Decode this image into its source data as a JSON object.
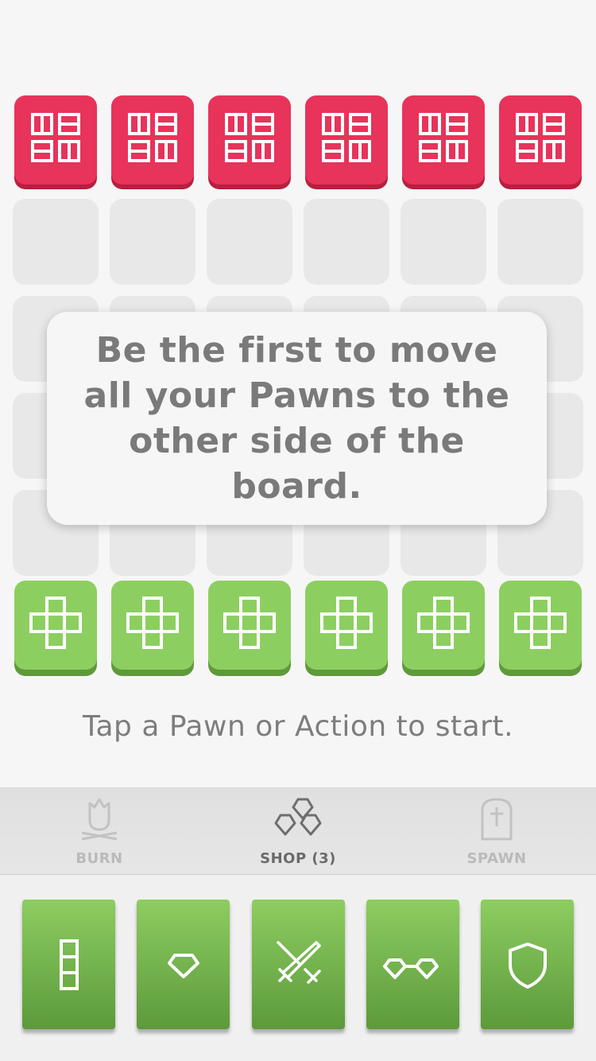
{
  "tooltip": {
    "text": "Be the first to move all your Pawns to the other side of the board."
  },
  "hint": "Tap a Pawn or Action to start.",
  "tabs": [
    {
      "label": "BURN",
      "icon": "fire-icon"
    },
    {
      "label": "SHOP (3)",
      "icon": "gems-icon"
    },
    {
      "label": "SPAWN",
      "icon": "tombstone-icon"
    }
  ],
  "cards": [
    {
      "icon": "column-icon"
    },
    {
      "icon": "gem-icon"
    },
    {
      "icon": "crossed-swords-icon"
    },
    {
      "icon": "double-gem-icon"
    },
    {
      "icon": "shield-icon"
    }
  ],
  "colors": {
    "opponent": "#e8335a",
    "player": "#8ccf60",
    "text": "#7a7a7a"
  }
}
